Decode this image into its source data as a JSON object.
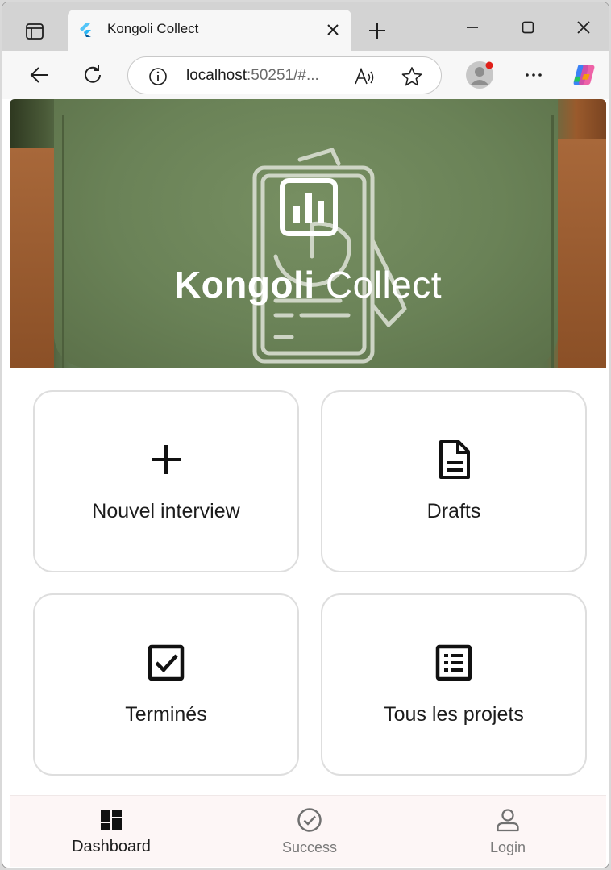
{
  "browser": {
    "tab": {
      "title": "Kongoli Collect",
      "favicon": "flutter-icon"
    },
    "address_bar": {
      "host": "localhost",
      "rest": ":50251/#..."
    },
    "icons": {
      "tab_actions": "tab-actions-icon",
      "close_tab": "close-icon",
      "new_tab": "plus-icon",
      "minimize": "minimize-icon",
      "maximize": "maximize-icon",
      "close_window": "close-icon",
      "back": "back-arrow-icon",
      "refresh": "refresh-icon",
      "site_info": "info-icon",
      "read_aloud": "read-aloud-icon",
      "favorite": "star-icon",
      "profile": "profile-icon",
      "more": "more-icon",
      "copilot": "copilot-icon"
    }
  },
  "app": {
    "hero": {
      "title_bold": "Kongoli",
      "title_regular": " Collect",
      "logo_icon": "bar-chart-icon"
    },
    "cards": [
      {
        "label": "Nouvel interview",
        "icon": "plus-icon"
      },
      {
        "label": "Drafts",
        "icon": "document-icon"
      },
      {
        "label": "Terminés",
        "icon": "checkbox-icon"
      },
      {
        "label": "Tous les projets",
        "icon": "list-icon"
      }
    ],
    "bottom_nav": {
      "items": [
        {
          "label": "Dashboard",
          "icon": "dashboard-icon",
          "active": true
        },
        {
          "label": "Success",
          "icon": "check-circle-icon",
          "active": false
        },
        {
          "label": "Login",
          "icon": "person-icon",
          "active": false
        }
      ]
    }
  },
  "colors": {
    "active_nav": "#1c1c1c",
    "inactive_nav": "#7a7a7a",
    "notification_dot": "#e0201a"
  }
}
